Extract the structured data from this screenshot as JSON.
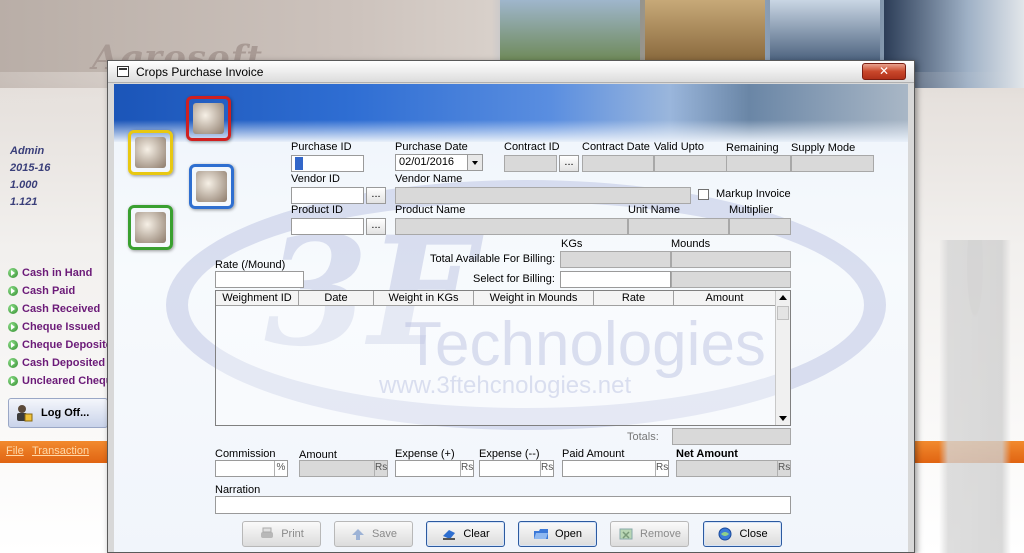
{
  "app": {
    "logo_text": "Agrosoft",
    "user_info": [
      "Admin",
      "2015-16",
      "1.000",
      "1.121"
    ],
    "side_menu": [
      "Cash in Hand",
      "Cash Paid",
      "Cash Received",
      "Cheque Issued",
      "Cheque Deposited",
      "Cash Deposited",
      "Uncleared Cheques"
    ],
    "logoff_label": "Log Off...",
    "menubar": [
      "File",
      "Transaction"
    ]
  },
  "dialog": {
    "title": "Crops Purchase Invoice",
    "close_glyph": "✕",
    "watermark": {
      "brand": "3F",
      "name": "Technologies",
      "url": "www.3ftehcnologies.net"
    },
    "labels": {
      "purchase_id": "Purchase ID",
      "purchase_date": "Purchase Date",
      "contract_id": "Contract ID",
      "contract_date": "Contract Date",
      "valid_upto": "Valid Upto",
      "remaining": "Remaining",
      "supply_mode": "Supply Mode",
      "vendor_id": "Vendor ID",
      "vendor_name": "Vendor Name",
      "markup_invoice": "Markup Invoice",
      "product_id": "Product ID",
      "product_name": "Product Name",
      "unit_name": "Unit Name",
      "multiplier": "Multiplier",
      "kgs": "KGs",
      "mounds": "Mounds",
      "total_available": "Total Available For Billing:",
      "select_for_billing": "Select for Billing:",
      "rate": "Rate (/Mound)",
      "totals": "Totals:",
      "commission": "Commission",
      "amount": "Amount",
      "expense_plus": "Expense (+)",
      "expense_minus": "Expense (--)",
      "paid_amount": "Paid Amount",
      "net_amount": "Net Amount",
      "narration": "Narration"
    },
    "values": {
      "purchase_id": "",
      "purchase_date": "02/01/2016",
      "markup_invoice_checked": false
    },
    "ellipsis": "...",
    "units": {
      "percent": "%",
      "rs": "Rs"
    },
    "grid_columns": [
      "Weighment ID",
      "Date",
      "Weight in KGs",
      "Weight in Mounds",
      "Rate",
      "Amount"
    ],
    "grid_rows": [],
    "buttons": [
      {
        "label": "Print",
        "enabled": false
      },
      {
        "label": "Save",
        "enabled": false
      },
      {
        "label": "Clear",
        "enabled": true
      },
      {
        "label": "Open",
        "enabled": true
      },
      {
        "label": "Remove",
        "enabled": false
      },
      {
        "label": "Close",
        "enabled": true
      }
    ]
  }
}
